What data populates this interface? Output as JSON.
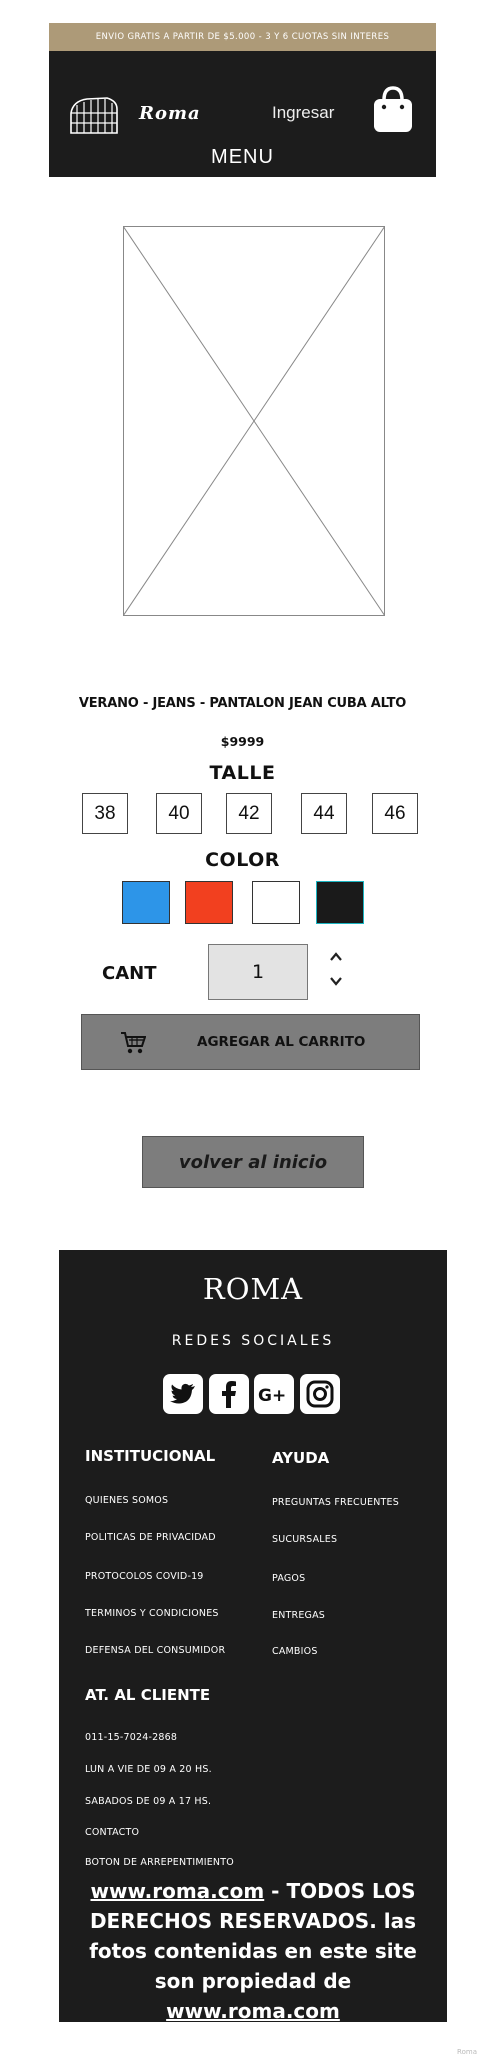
{
  "promo": "ENVIO GRATIS A PARTIR DE $5.000 - 3 Y 6 CUOTAS SIN INTERES",
  "header": {
    "brand": "Roma",
    "login": "Ingresar",
    "menu": "MENU"
  },
  "product": {
    "title": "VERANO - JEANS - PANTALON JEAN CUBA ALTO",
    "price": "$9999",
    "size_label": "TALLE",
    "sizes": [
      "38",
      "40",
      "42",
      "44",
      "46"
    ],
    "color_label": "COLOR",
    "colors": [
      "#2d95e8",
      "#f2401f",
      "#ffffff",
      "#1a1a1a"
    ],
    "qty_label": "CANT",
    "qty": "1",
    "add_to_cart": "AGREGAR AL CARRITO"
  },
  "back_button": "volver al inicio",
  "footer": {
    "brand": "ROMA",
    "social_title": "REDES SOCIALES",
    "social_icons": [
      "twitter-icon",
      "facebook-icon",
      "google-plus-icon",
      "instagram-icon"
    ],
    "institucional": {
      "title": "INSTITUCIONAL",
      "links": [
        "QUIENES SOMOS",
        "POLITICAS DE PRIVACIDAD",
        "PROTOCOLOS COVID-19",
        "TERMINOS Y CONDICIONES",
        "DEFENSA DEL CONSUMIDOR"
      ]
    },
    "ayuda": {
      "title": "AYUDA",
      "links": [
        "PREGUNTAS FRECUENTES",
        "SUCURSALES",
        "PAGOS",
        "ENTREGAS",
        "CAMBIOS"
      ]
    },
    "cliente": {
      "title": "AT. AL CLIENTE",
      "links": [
        "011-15-7024-2868",
        "LUN A VIE DE 09 A 20 HS.",
        "SABADOS DE 09 A 17 HS.",
        "CONTACTO",
        "BOTON DE ARREPENTIMIENTO"
      ]
    },
    "copyright": {
      "site1": "www.roma.com",
      "text": " - TODOS LOS DERECHOS RESERVADOS. las fotos contenidas en este site son propiedad de ",
      "site2": "www.roma.com"
    }
  },
  "watermark": "Roma"
}
